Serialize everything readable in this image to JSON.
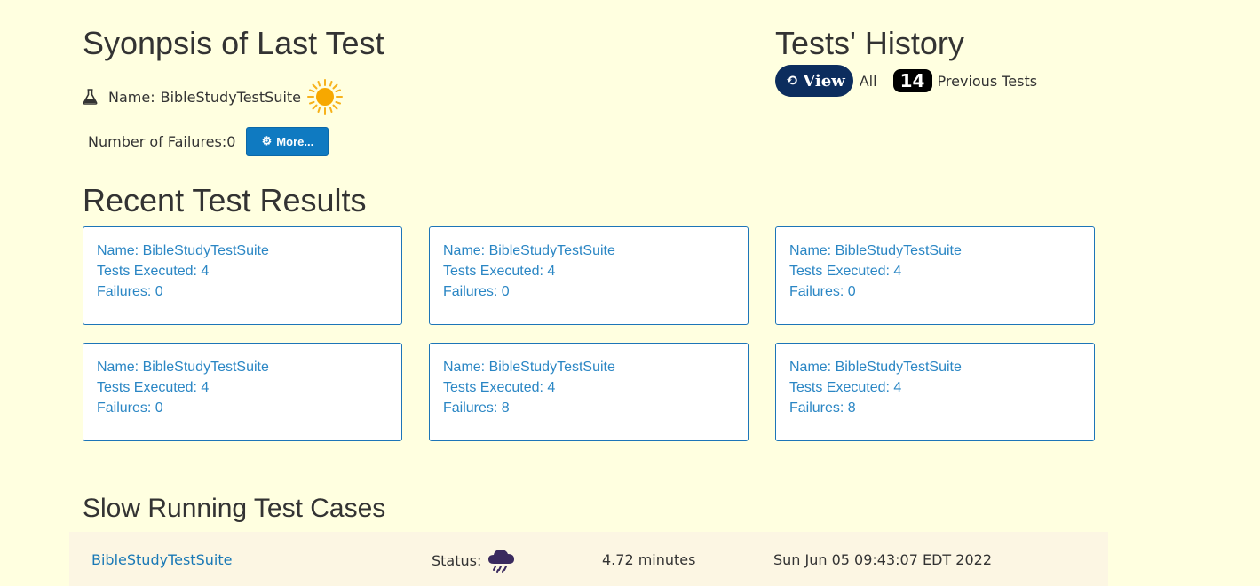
{
  "synopsis": {
    "title": "Syonpsis of Last Test",
    "name_label": "Name:",
    "name_value": "BibleStudyTestSuite",
    "status_icon": "sun-icon",
    "failures_label": "Number of Failures:",
    "failures_value": "0",
    "more_button_label": "More..."
  },
  "history": {
    "title": "Tests' History",
    "view_button_label": "View",
    "all_label": "All",
    "count": "14",
    "previous_label": "Previous Tests"
  },
  "recent": {
    "title": "Recent Test Results",
    "cards": [
      {
        "name": "Name: BibleStudyTestSuite",
        "executed": "Tests Executed: 4",
        "failures": "Failures: 0"
      },
      {
        "name": "Name: BibleStudyTestSuite",
        "executed": "Tests Executed: 4",
        "failures": "Failures: 0"
      },
      {
        "name": "Name: BibleStudyTestSuite",
        "executed": "Tests Executed: 4",
        "failures": "Failures: 0"
      },
      {
        "name": "Name: BibleStudyTestSuite",
        "executed": "Tests Executed: 4",
        "failures": "Failures: 0"
      },
      {
        "name": "Name: BibleStudyTestSuite",
        "executed": "Tests Executed: 4",
        "failures": "Failures: 8"
      },
      {
        "name": "Name: BibleStudyTestSuite",
        "executed": "Tests Executed: 4",
        "failures": "Failures: 8"
      }
    ]
  },
  "slow": {
    "title": "Slow Running Test Cases",
    "rows": [
      {
        "name": "BibleStudyTestSuite",
        "status_label": "Status:",
        "status_icon": "storm-cloud-icon",
        "duration": "4.72 minutes",
        "date": "Sun Jun 05 09:43:07 EDT 2022"
      }
    ]
  },
  "colors": {
    "page_background": "#ffffe0",
    "accent_blue": "#0f7ac1",
    "history_button": "#0c2d5e",
    "card_link": "#2a86c4",
    "slow_row_background": "#fcf6e3"
  }
}
